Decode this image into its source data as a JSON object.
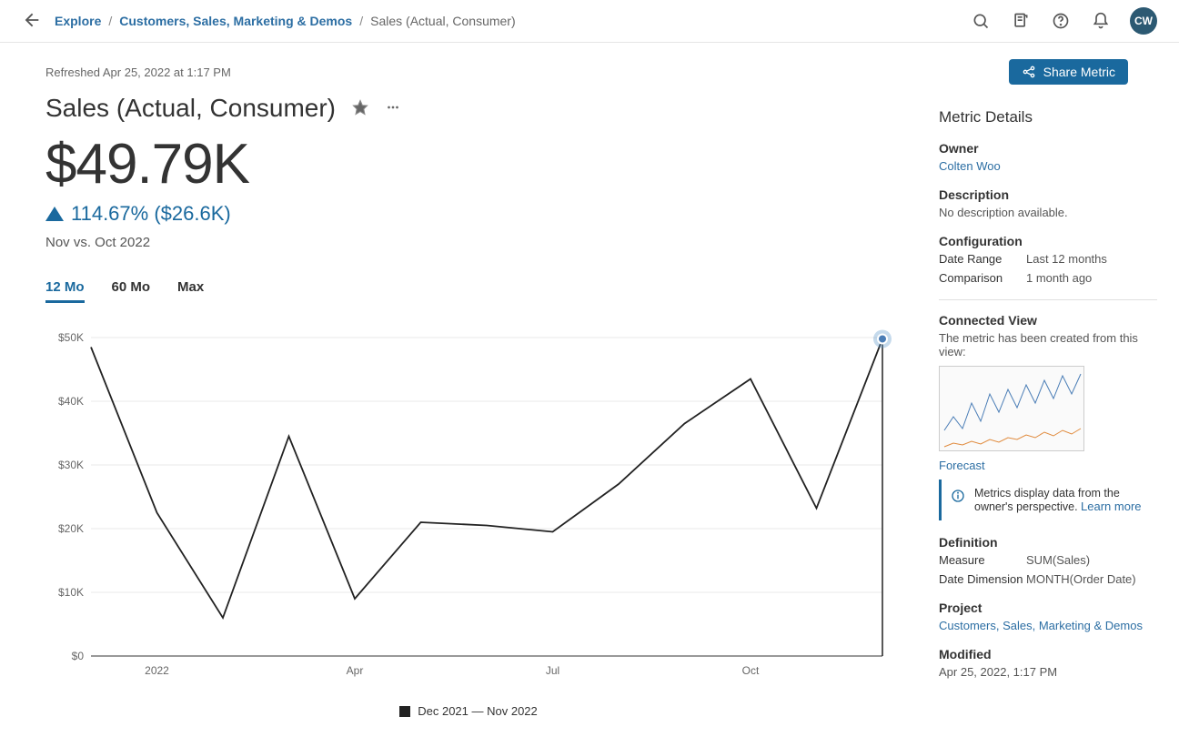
{
  "topbar": {
    "breadcrumb": {
      "root": "Explore",
      "mid": "Customers, Sales, Marketing & Demos",
      "current": "Sales (Actual, Consumer)"
    },
    "avatar": "CW"
  },
  "header": {
    "refreshed": "Refreshed Apr 25, 2022 at 1:17 PM",
    "share": "Share Metric",
    "title": "Sales (Actual, Consumer)"
  },
  "metric": {
    "value": "$49.79K",
    "delta": "114.67% ($26.6K)",
    "compare": "Nov vs. Oct 2022"
  },
  "tabs": {
    "t12": "12 Mo",
    "t60": "60 Mo",
    "tmax": "Max"
  },
  "legend": "Dec 2021 — Nov 2022",
  "side": {
    "heading": "Metric Details",
    "ownerLabel": "Owner",
    "owner": "Colten Woo",
    "descLabel": "Description",
    "desc": "No description available.",
    "configLabel": "Configuration",
    "dateRangeK": "Date Range",
    "dateRangeV": "Last 12 months",
    "compareK": "Comparison",
    "compareV": "1 month ago",
    "connectedLabel": "Connected View",
    "connectedText": "The metric has been created from this view:",
    "forecast": "Forecast",
    "info": "Metrics display data from the owner's perspective. ",
    "learn": "Learn more",
    "definitionLabel": "Definition",
    "measureK": "Measure",
    "measureV": "SUM(Sales)",
    "dateDimK": "Date Dimension",
    "dateDimV": "MONTH(Order Date)",
    "projectLabel": "Project",
    "project": "Customers, Sales, Marketing & Demos",
    "modifiedLabel": "Modified",
    "modified": "Apr 25, 2022, 1:17 PM"
  },
  "chart_data": {
    "type": "line",
    "title": "",
    "xlabel": "",
    "ylabel": "",
    "ylim": [
      0,
      50000
    ],
    "x": [
      "Dec 2021",
      "Jan 2022",
      "Feb 2022",
      "Mar 2022",
      "Apr 2022",
      "May 2022",
      "Jun 2022",
      "Jul 2022",
      "Aug 2022",
      "Sep 2022",
      "Oct 2022",
      "Nov 2022"
    ],
    "x_tick_labels": [
      "2022",
      "Apr",
      "Jul",
      "Oct"
    ],
    "y_tick_labels": [
      "$0",
      "$10K",
      "$20K",
      "$30K",
      "$40K",
      "$50K"
    ],
    "series": [
      {
        "name": "Dec 2021 — Nov 2022",
        "values": [
          48500,
          22500,
          6000,
          34500,
          9000,
          21000,
          20500,
          19500,
          27000,
          36500,
          43500,
          23200,
          49790
        ]
      }
    ],
    "_note": "13 points plotted Dec 2021 through Nov 2022 with Oct partial + Nov final; values estimated from gridlines, final point = $49.79K"
  }
}
